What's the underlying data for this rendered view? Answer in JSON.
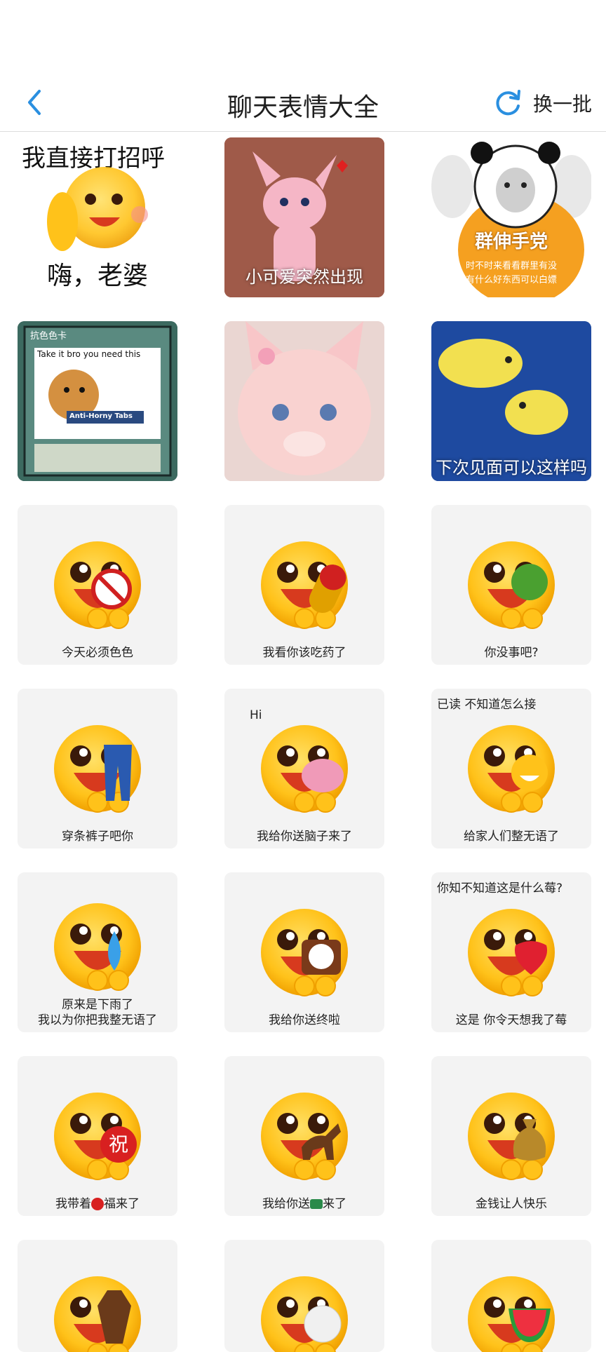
{
  "header": {
    "title": "聊天表情大全",
    "refresh_label": "换一批"
  },
  "stickers": {
    "s1": {
      "line1": "我直接打招呼",
      "line2": "嗨，老婆"
    },
    "s2": {
      "caption": "小可爱突然出现"
    },
    "s3": {
      "caption": "群伸手党",
      "sub1": "时不时来看看群里有没",
      "sub2": "有什么好东西可以白嫖"
    },
    "s4": {
      "card_title": "抗色色卡",
      "top_text": "Take it bro you need this",
      "banner": "Anti-Horny Tabs"
    },
    "s5": {
      "caption": ""
    },
    "s6": {
      "caption": "下次见面可以这样吗"
    },
    "s7": {
      "caption": "今天必须色色"
    },
    "s8": {
      "caption": "我看你该吃药了"
    },
    "s9": {
      "caption": "你没事吧?"
    },
    "s10": {
      "caption": "穿条裤子吧你"
    },
    "s11": {
      "top": "Hi",
      "caption": "我给你送脑子来了"
    },
    "s12": {
      "top": "已读 不知道怎么接",
      "caption": "给家人们整无语了"
    },
    "s13": {
      "line1": "原来是下雨了",
      "line2": "我以为你把我整无语了"
    },
    "s14": {
      "caption": "我给你送终啦"
    },
    "s15": {
      "top": "你知不知道这是什么莓?",
      "caption": "这是 你令天想我了莓"
    },
    "s16": {
      "caption_a": "我带着",
      "caption_b": "福来了",
      "badge": "祝"
    },
    "s17": {
      "caption_a": "我给你送",
      "caption_b": "来了"
    },
    "s18": {
      "caption": "金钱让人快乐"
    },
    "s19": {
      "caption": ""
    },
    "s20": {
      "caption": ""
    },
    "s21": {
      "caption": ""
    }
  },
  "colors": {
    "accent": "#2a8fe0",
    "face": "#ffc21a",
    "face_edge": "#f0a000",
    "mouth": "#d73a1e"
  }
}
